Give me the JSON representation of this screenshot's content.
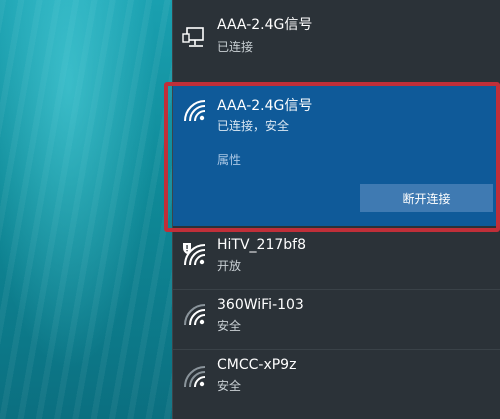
{
  "networks": {
    "wired": {
      "name": "AAA-2.4G信号",
      "status": "已连接",
      "icon": "ethernet-icon"
    },
    "selected": {
      "name": "AAA-2.4G信号",
      "status": "已连接，安全",
      "properties_label": "属性",
      "disconnect_label": "断开连接",
      "icon": "wifi-icon"
    },
    "list": [
      {
        "name": "HiTV_217bf8",
        "status": "开放",
        "icon": "wifi-warning-icon"
      },
      {
        "name": "360WiFi-103",
        "status": "安全",
        "icon": "wifi-icon"
      },
      {
        "name": "CMCC-xP9z",
        "status": "安全",
        "icon": "wifi-icon"
      }
    ]
  },
  "colors": {
    "selected_bg": "#0f5a99",
    "highlight_border": "#c02f39",
    "panel_bg": "#2b3238"
  }
}
